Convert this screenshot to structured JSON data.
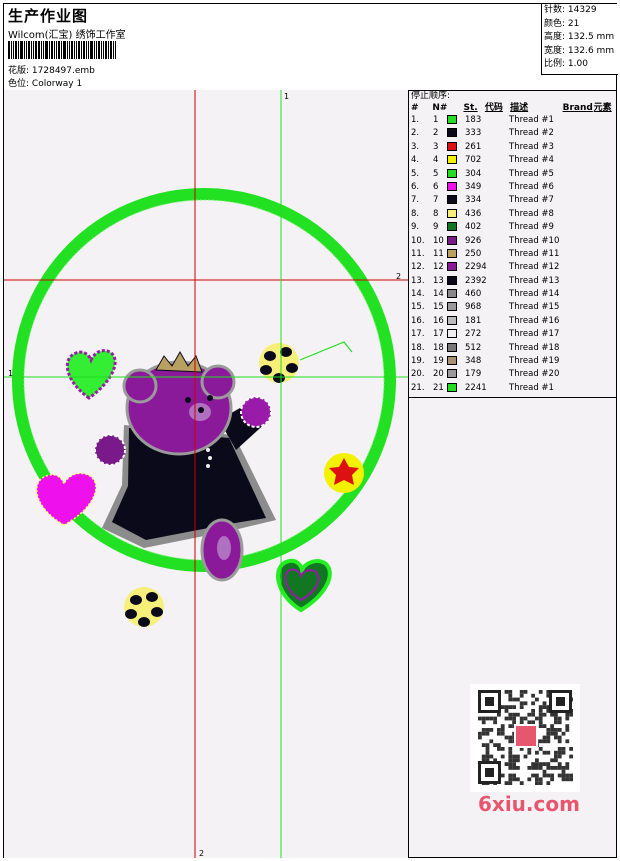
{
  "header": {
    "title": "生产作业图",
    "company": "Wilcom(汇宝) 绣饰工作室",
    "design_label": "花版:",
    "design_value": "1728497.emb",
    "colorway_label": "色位:",
    "colorway_value": "Colorway 1"
  },
  "stats": {
    "stitches_label": "针数:",
    "stitches_value": "14329",
    "colors_label": "颜色:",
    "colors_value": "21",
    "height_label": "高度:",
    "height_value": "132.5 mm",
    "width_label": "宽度:",
    "width_value": "132.6 mm",
    "scale_label": "比例:",
    "scale_value": "1.00"
  },
  "guides": {
    "label_1": "1",
    "label_2": "2"
  },
  "stop_sequence": {
    "title": "停止顺序:",
    "headers": {
      "num": "#",
      "no": "N#",
      "st": "St.",
      "code": "代码",
      "desc": "描述",
      "brand": "Brand",
      "element": "元素"
    },
    "rows": [
      {
        "num": "1.",
        "n": "1",
        "color": "#22dd22",
        "st": "183",
        "desc": "Thread #1"
      },
      {
        "num": "2.",
        "n": "2",
        "color": "#0a0a1a",
        "st": "333",
        "desc": "Thread #2"
      },
      {
        "num": "3.",
        "n": "3",
        "color": "#dd1111",
        "st": "261",
        "desc": "Thread #3"
      },
      {
        "num": "4.",
        "n": "4",
        "color": "#f2f200",
        "st": "702",
        "desc": "Thread #4"
      },
      {
        "num": "5.",
        "n": "5",
        "color": "#22dd22",
        "st": "304",
        "desc": "Thread #5"
      },
      {
        "num": "6.",
        "n": "6",
        "color": "#ee11ee",
        "st": "349",
        "desc": "Thread #6"
      },
      {
        "num": "7.",
        "n": "7",
        "color": "#0a0a1a",
        "st": "334",
        "desc": "Thread #7"
      },
      {
        "num": "8.",
        "n": "8",
        "color": "#f6f07a",
        "st": "436",
        "desc": "Thread #8"
      },
      {
        "num": "9.",
        "n": "9",
        "color": "#117722",
        "st": "402",
        "desc": "Thread #9"
      },
      {
        "num": "10.",
        "n": "10",
        "color": "#7a1a8a",
        "st": "926",
        "desc": "Thread #10"
      },
      {
        "num": "11.",
        "n": "11",
        "color": "#b8a060",
        "st": "250",
        "desc": "Thread #11"
      },
      {
        "num": "12.",
        "n": "12",
        "color": "#8a1a9a",
        "st": "2294",
        "desc": "Thread #12"
      },
      {
        "num": "13.",
        "n": "13",
        "color": "#0a0a1a",
        "st": "2392",
        "desc": "Thread #13"
      },
      {
        "num": "14.",
        "n": "14",
        "color": "#888888",
        "st": "460",
        "desc": "Thread #14"
      },
      {
        "num": "15.",
        "n": "15",
        "color": "#999999",
        "st": "968",
        "desc": "Thread #15"
      },
      {
        "num": "16.",
        "n": "16",
        "color": "#bbbbbb",
        "st": "181",
        "desc": "Thread #16"
      },
      {
        "num": "17.",
        "n": "17",
        "color": "#eeeeee",
        "st": "272",
        "desc": "Thread #17"
      },
      {
        "num": "18.",
        "n": "18",
        "color": "#777777",
        "st": "512",
        "desc": "Thread #18"
      },
      {
        "num": "19.",
        "n": "19",
        "color": "#a89070",
        "st": "348",
        "desc": "Thread #19"
      },
      {
        "num": "20.",
        "n": "20",
        "color": "#999999",
        "st": "179",
        "desc": "Thread #20"
      },
      {
        "num": "21.",
        "n": "21",
        "color": "#22dd22",
        "st": "2241",
        "desc": "Thread #1"
      }
    ]
  },
  "watermark": "6xiu.com",
  "colors": {
    "red_guide": "#cc0000",
    "green_guide": "#22dd22",
    "frame": "#22e022"
  }
}
